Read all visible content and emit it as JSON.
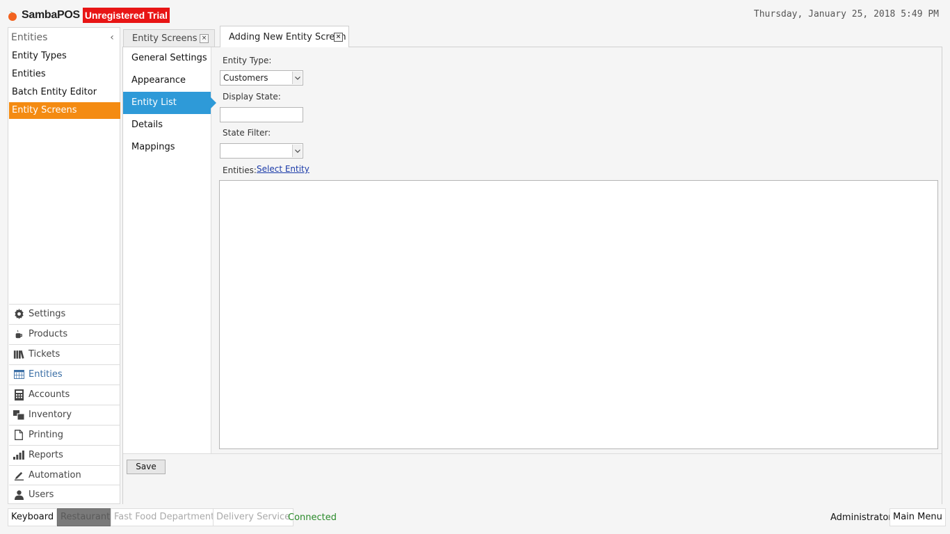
{
  "header": {
    "app_name": "SambaPOS",
    "trial_badge": "Unregistered Trial",
    "datetime": "Thursday, January 25, 2018 5:49 PM"
  },
  "sidebar": {
    "title": "Entities",
    "collapse_glyph": "‹",
    "items": [
      {
        "label": "Entity Types",
        "active": false
      },
      {
        "label": "Entities",
        "active": false
      },
      {
        "label": "Batch Entity Editor",
        "active": false
      },
      {
        "label": "Entity Screens",
        "active": true
      }
    ],
    "nav": [
      {
        "label": "Settings",
        "icon": "gear-icon"
      },
      {
        "label": "Products",
        "icon": "coffee-cup-icon"
      },
      {
        "label": "Tickets",
        "icon": "books-icon"
      },
      {
        "label": "Entities",
        "icon": "table-icon",
        "active": true
      },
      {
        "label": "Accounts",
        "icon": "calculator-icon"
      },
      {
        "label": "Inventory",
        "icon": "boxes-icon"
      },
      {
        "label": "Printing",
        "icon": "document-icon"
      },
      {
        "label": "Reports",
        "icon": "bar-chart-icon"
      },
      {
        "label": "Automation",
        "icon": "pencil-icon"
      },
      {
        "label": "Users",
        "icon": "user-icon"
      }
    ]
  },
  "tabs": [
    {
      "label": "Entity Screens",
      "close": "×"
    },
    {
      "label": "Adding New Entity Screen",
      "close": "×",
      "active": true
    }
  ],
  "subnav": [
    {
      "label": "General Settings"
    },
    {
      "label": "Appearance"
    },
    {
      "label": "Entity List",
      "active": true
    },
    {
      "label": "Details"
    },
    {
      "label": "Mappings"
    }
  ],
  "form": {
    "entity_type_label": "Entity Type:",
    "entity_type_value": "Customers",
    "display_state_label": "Display State:",
    "display_state_value": "",
    "state_filter_label": "State Filter:",
    "state_filter_value": "",
    "entities_label": "Entities:",
    "select_entity_link": "Select Entity",
    "save_label": "Save"
  },
  "footer": {
    "keyboard": "Keyboard",
    "restaurant": "Restaurant",
    "fast_food": "Fast Food Department",
    "delivery": "Delivery Service",
    "status": "Connected",
    "user": "Administrator",
    "main_menu": "Main Menu"
  },
  "colors": {
    "accent_orange": "#f48b12",
    "accent_blue": "#2e9ad8",
    "trial_red": "#e81515",
    "status_green": "#2a8a2a"
  }
}
